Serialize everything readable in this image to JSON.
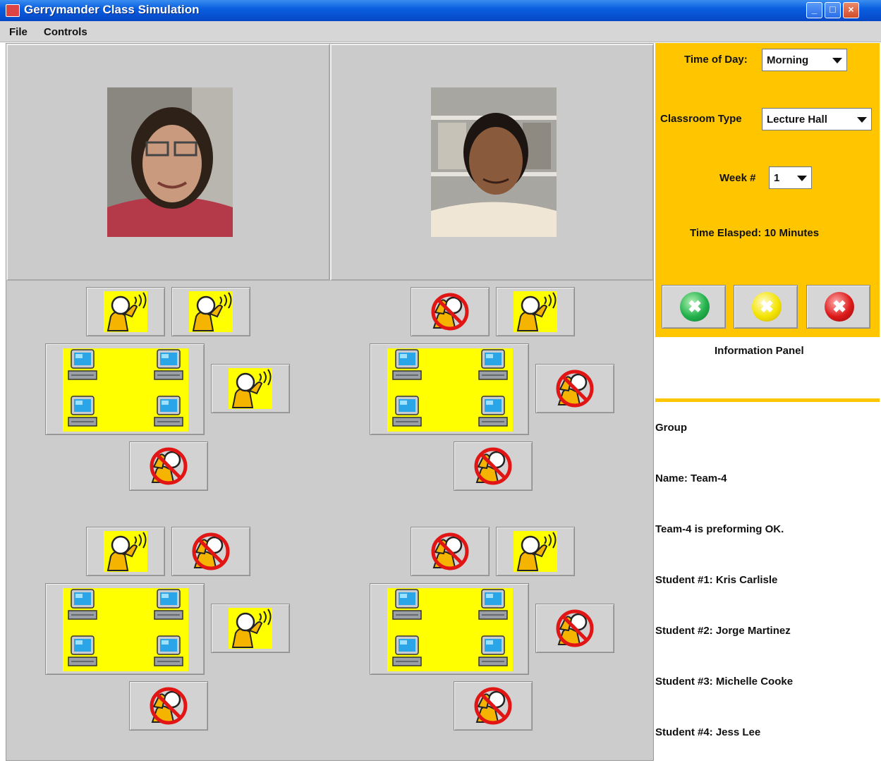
{
  "window": {
    "title": "Gerrymander Class Simulation"
  },
  "menu": {
    "items": [
      "File",
      "Controls"
    ]
  },
  "controls": {
    "time_of_day_label": "Time of Day:",
    "time_of_day_value": "Morning",
    "classroom_type_label": "Classroom Type",
    "classroom_type_value": "Lecture Hall",
    "week_label": "Week #",
    "week_value": "1",
    "time_elapsed": "Time Elasped: 10 Minutes",
    "status_buttons": [
      {
        "name": "green",
        "color": "#22b14c"
      },
      {
        "name": "yellow",
        "color": "#f4e400"
      },
      {
        "name": "red",
        "color": "#dd1a1a"
      }
    ]
  },
  "info_panel": {
    "title": "Information Panel",
    "lines": [
      "Group",
      "Name: Team-4",
      "Team-4 is preforming OK.",
      "Student #1: Kris Carlisle",
      "Student #2: Jorge Martinez",
      "Student #3: Michelle Cooke",
      "Student #4: Jess Lee"
    ]
  },
  "colors": {
    "accent": "#ffc600",
    "table": "#ffff00",
    "titlebar": "#0a5fe0"
  },
  "groups": [
    {
      "name": "group-1",
      "top_left": "raised-hand",
      "top_right": "raised-hand",
      "side": "raised-hand",
      "bottom": "no-hand"
    },
    {
      "name": "group-2",
      "top_left": "no-hand",
      "top_right": "raised-hand",
      "side": "no-hand",
      "bottom": "no-hand"
    },
    {
      "name": "group-3",
      "top_left": "raised-hand",
      "top_right": "no-hand",
      "side": "raised-hand",
      "bottom": "no-hand"
    },
    {
      "name": "group-4",
      "top_left": "no-hand",
      "top_right": "raised-hand",
      "side": "no-hand",
      "bottom": "no-hand"
    }
  ]
}
